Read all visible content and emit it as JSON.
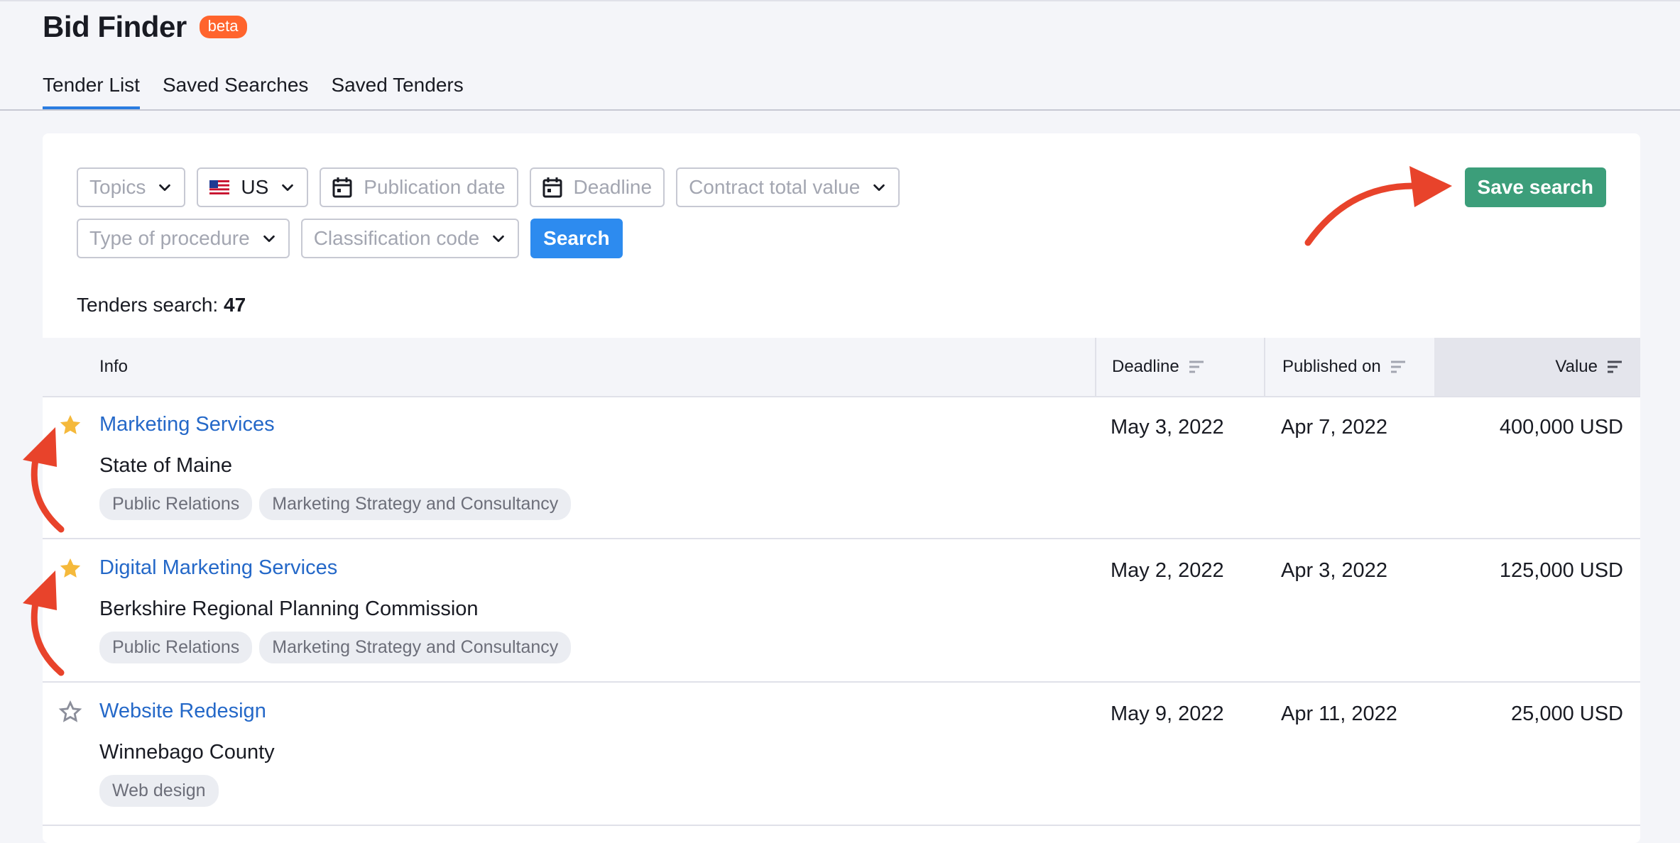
{
  "app": {
    "title": "Bid Finder",
    "badge": "beta"
  },
  "tabs": [
    {
      "label": "Tender List",
      "active": true
    },
    {
      "label": "Saved Searches",
      "active": false
    },
    {
      "label": "Saved Tenders",
      "active": false
    }
  ],
  "filters": {
    "topics": "Topics",
    "country": "US",
    "publication_date": "Publication date",
    "deadline": "Deadline",
    "contract_value": "Contract total value",
    "procedure": "Type of procedure",
    "classification": "Classification code",
    "search_label": "Search",
    "save_search_label": "Save search"
  },
  "results": {
    "label": "Tenders search:",
    "count": "47"
  },
  "table": {
    "headers": {
      "info": "Info",
      "deadline": "Deadline",
      "published": "Published on",
      "value": "Value"
    },
    "rows": [
      {
        "title": "Marketing Services",
        "org": "State of Maine",
        "tags": [
          "Public Relations",
          "Marketing Strategy and Consultancy"
        ],
        "deadline": "May 3, 2022",
        "published": "Apr 7, 2022",
        "value": "400,000 USD",
        "starred": true
      },
      {
        "title": "Digital Marketing Services",
        "org": "Berkshire Regional Planning Commission",
        "tags": [
          "Public Relations",
          "Marketing Strategy and Consultancy"
        ],
        "deadline": "May 2, 2022",
        "published": "Apr 3, 2022",
        "value": "125,000 USD",
        "starred": true
      },
      {
        "title": "Website Redesign",
        "org": "Winnebago County",
        "tags": [
          "Web design"
        ],
        "deadline": "May 9, 2022",
        "published": "Apr 11, 2022",
        "value": "25,000 USD",
        "starred": false
      }
    ]
  },
  "colors": {
    "accent_blue": "#2d8bef",
    "save_green": "#3c9e7a",
    "star_yellow": "#f5b93b",
    "annotation_red": "#e8432b",
    "badge_orange": "#ff642d"
  },
  "icons": [
    "chevron-down-icon",
    "calendar-icon",
    "us-flag-icon",
    "sort-icon",
    "star-filled-icon",
    "star-outline-icon",
    "annotation-arrow"
  ]
}
